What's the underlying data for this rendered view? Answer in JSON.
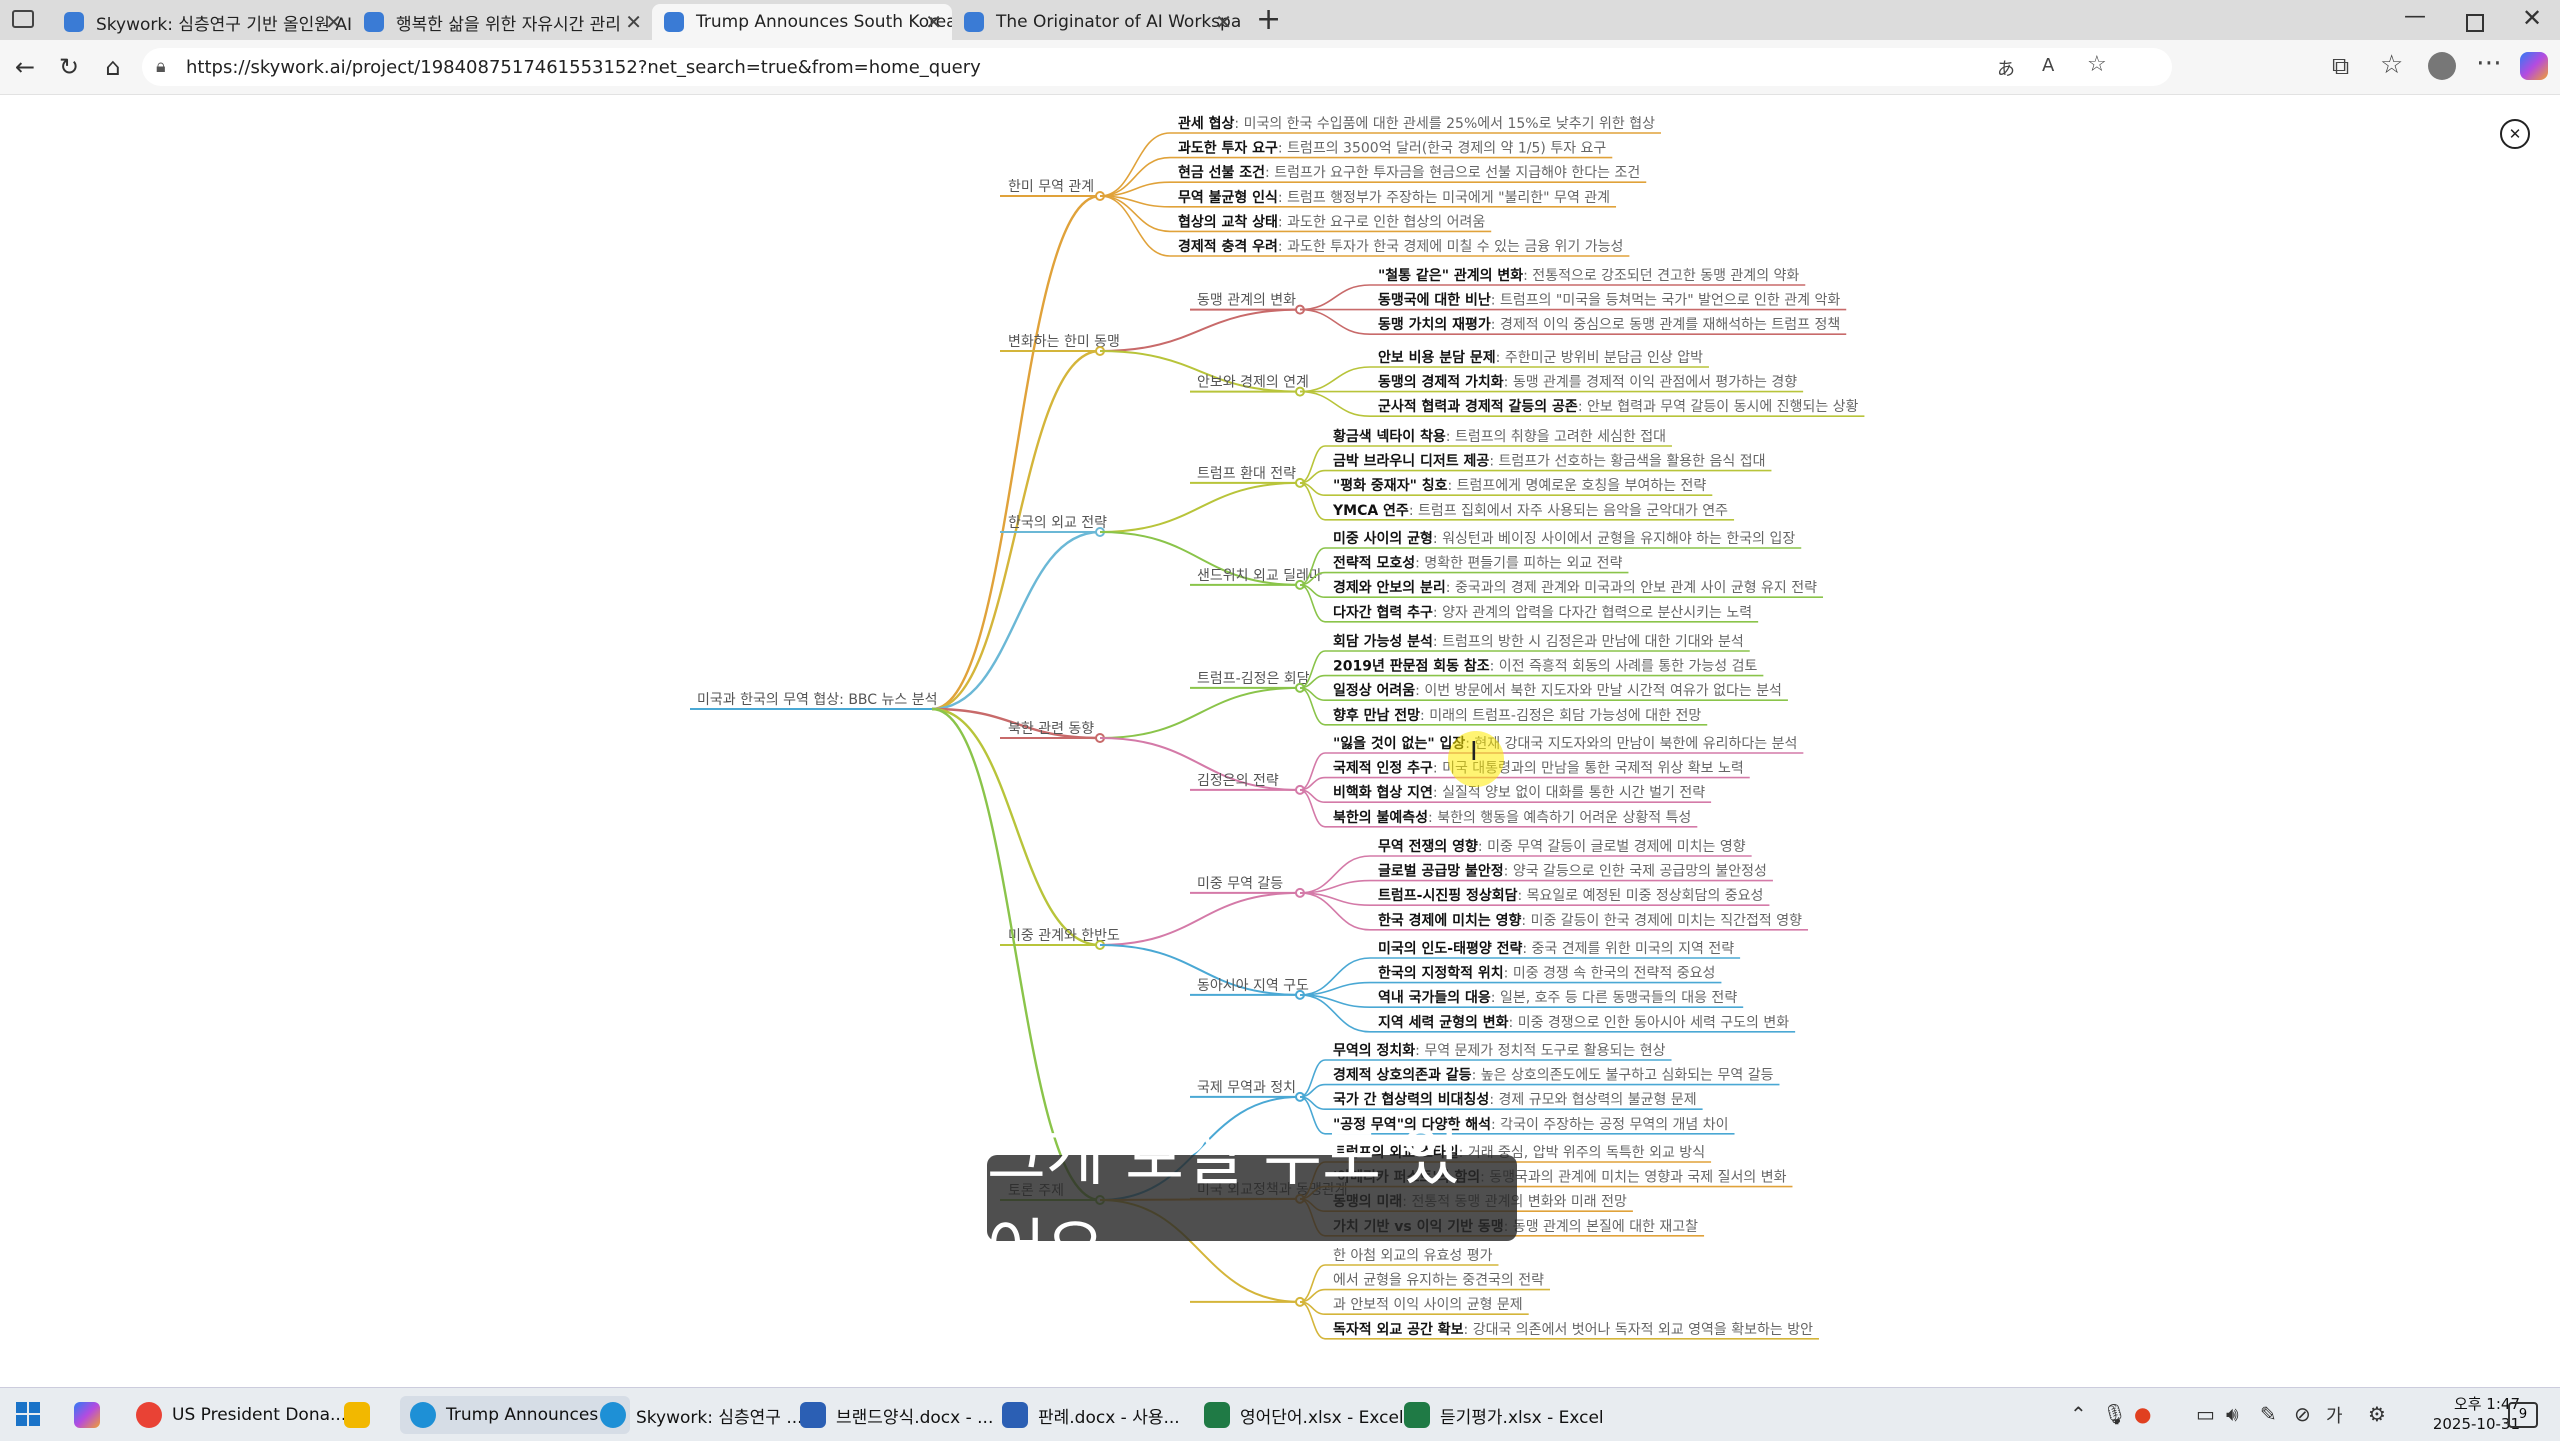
{
  "browser": {
    "tabs": [
      {
        "title": "Skywork: 심층연구 기반 올인원 AI",
        "favicon_color": "#3a7bd5"
      },
      {
        "title": "행복한 삶을 위한 자유시간 관리",
        "favicon_color": "#3a7bd5"
      },
      {
        "title": "Trump Announces South Korea Tr",
        "favicon_color": "#3a7bd5"
      },
      {
        "title": "The Originator of AI Workspace: A",
        "favicon_color": "#3a7bd5"
      }
    ],
    "active_tab": 2,
    "url": "https://skywork.ai/project/1984087517461553152?net_search=true&from=home_query"
  },
  "mindmap": {
    "root": "미국과 한국의 무역 협상: BBC 뉴스 분석",
    "colors": [
      "#e0a23a",
      "#d4b53a",
      "#6bb8d6",
      "#c86a6a",
      "#b8c43a",
      "#8ac44a",
      "#d47aa8",
      "#4aa8d4"
    ],
    "branches": [
      {
        "label": "한미 무역 관계",
        "leaves": [
          {
            "b": "관세 협상",
            "t": ": 미국의 한국 수입품에 대한 관세를 25%에서 15%로 낮추기 위한 협상"
          },
          {
            "b": "과도한 투자 요구",
            "t": ": 트럼프의 3500억 달러(한국 경제의 약 1/5) 투자 요구"
          },
          {
            "b": "현금 선불 조건",
            "t": ": 트럼프가 요구한 투자금을 현금으로 선불 지급해야 한다는 조건"
          },
          {
            "b": "무역 불균형 인식",
            "t": ": 트럼프 행정부가 주장하는 미국에게 \"불리한\" 무역 관계"
          },
          {
            "b": "협상의 교착 상태",
            "t": ": 과도한 요구로 인한 협상의 어려움"
          },
          {
            "b": "경제적 충격 우려",
            "t": ": 과도한 투자가 한국 경제에 미칠 수 있는 금융 위기 가능성"
          }
        ]
      },
      {
        "label": "변화하는 한미 동맹",
        "subs": [
          {
            "label": "동맹 관계의 변화",
            "leaves": [
              {
                "b": "\"철통 같은\" 관계의 변화",
                "t": ": 전통적으로 강조되던 견고한 동맹 관계의 약화"
              },
              {
                "b": "동맹국에 대한 비난",
                "t": ": 트럼프의 \"미국을 등쳐먹는 국가\" 발언으로 인한 관계 악화"
              },
              {
                "b": "동맹 가치의 재평가",
                "t": ": 경제적 이익 중심으로 동맹 관계를 재해석하는 트럼프 정책"
              }
            ]
          },
          {
            "label": "안보와 경제의 연계",
            "leaves": [
              {
                "b": "안보 비용 분담 문제",
                "t": ": 주한미군 방위비 분담금 인상 압박"
              },
              {
                "b": "동맹의 경제적 가치화",
                "t": ": 동맹 관계를 경제적 이익 관점에서 평가하는 경향"
              },
              {
                "b": "군사적 협력과 경제적 갈등의 공존",
                "t": ": 안보 협력과 무역 갈등이 동시에 진행되는 상황"
              }
            ]
          }
        ]
      },
      {
        "label": "한국의 외교 전략",
        "subs": [
          {
            "label": "트럼프 환대 전략",
            "leaves": [
              {
                "b": "황금색 넥타이 착용",
                "t": ": 트럼프의 취향을 고려한 세심한 접대"
              },
              {
                "b": "금박 브라우니 디저트 제공",
                "t": ": 트럼프가 선호하는 황금색을 활용한 음식 접대"
              },
              {
                "b": "\"평화 중재자\" 칭호",
                "t": ": 트럼프에게 명예로운 호칭을 부여하는 전략"
              },
              {
                "b": "YMCA 연주",
                "t": ": 트럼프 집회에서 자주 사용되는 음악을 군악대가 연주"
              }
            ]
          },
          {
            "label": "샌드위치 외교 딜레마",
            "leaves": [
              {
                "b": "미중 사이의 균형",
                "t": ": 워싱턴과 베이징 사이에서 균형을 유지해야 하는 한국의 입장"
              },
              {
                "b": "전략적 모호성",
                "t": ": 명확한 편들기를 피하는 외교 전략"
              },
              {
                "b": "경제와 안보의 분리",
                "t": ": 중국과의 경제 관계와 미국과의 안보 관계 사이 균형 유지 전략"
              },
              {
                "b": "다자간 협력 추구",
                "t": ": 양자 관계의 압력을 다자간 협력으로 분산시키는 노력"
              }
            ]
          }
        ]
      },
      {
        "label": "북한 관련 동향",
        "subs": [
          {
            "label": "트럼프-김정은 회담",
            "leaves": [
              {
                "b": "회담 가능성 분석",
                "t": ": 트럼프의 방한 시 김정은과 만남에 대한 기대와 분석"
              },
              {
                "b": "2019년 판문점 회동 참조",
                "t": ": 이전 즉흥적 회동의 사례를 통한 가능성 검토"
              },
              {
                "b": "일정상 어려움",
                "t": ": 이번 방문에서 북한 지도자와 만날 시간적 여유가 없다는 분석"
              },
              {
                "b": "향후 만남 전망",
                "t": ": 미래의 트럼프-김정은 회담 가능성에 대한 전망"
              }
            ]
          },
          {
            "label": "김정은의 전략",
            "leaves": [
              {
                "b": "\"잃을 것이 없는\" 입장",
                "t": ": 현재 강대국 지도자와의 만남이 북한에 유리하다는 분석"
              },
              {
                "b": "국제적 인정 추구",
                "t": ": 미국 대통령과의 만남을 통한 국제적 위상 확보 노력"
              },
              {
                "b": "비핵화 협상 지연",
                "t": ": 실질적 양보 없이 대화를 통한 시간 벌기 전략"
              },
              {
                "b": "북한의 불예측성",
                "t": ": 북한의 행동을 예측하기 어려운 상황적 특성"
              }
            ]
          }
        ]
      },
      {
        "label": "미중 관계와 한반도",
        "subs": [
          {
            "label": "미중 무역 갈등",
            "leaves": [
              {
                "b": "무역 전쟁의 영향",
                "t": ": 미중 무역 갈등이 글로벌 경제에 미치는 영향"
              },
              {
                "b": "글로벌 공급망 불안정",
                "t": ": 양국 갈등으로 인한 국제 공급망의 불안정성"
              },
              {
                "b": "트럼프-시진핑 정상회담",
                "t": ": 목요일로 예정된 미중 정상회담의 중요성"
              },
              {
                "b": "한국 경제에 미치는 영향",
                "t": ": 미중 갈등이 한국 경제에 미치는 직간접적 영향"
              }
            ]
          },
          {
            "label": "동아시아 지역 구도",
            "leaves": [
              {
                "b": "미국의 인도-태평양 전략",
                "t": ": 중국 견제를 위한 미국의 지역 전략"
              },
              {
                "b": "한국의 지정학적 위치",
                "t": ": 미중 경쟁 속 한국의 전략적 중요성"
              },
              {
                "b": "역내 국가들의 대응",
                "t": ": 일본, 호주 등 다른 동맹국들의 대응 전략"
              },
              {
                "b": "지역 세력 균형의 변화",
                "t": ": 미중 경쟁으로 인한 동아시아 세력 구도의 변화"
              }
            ]
          }
        ]
      },
      {
        "label": "토론 주제",
        "subs": [
          {
            "label": "국제 무역과 정치",
            "leaves": [
              {
                "b": "무역의 정치화",
                "t": ": 무역 문제가 정치적 도구로 활용되는 현상"
              },
              {
                "b": "경제적 상호의존과 갈등",
                "t": ": 높은 상호의존도에도 불구하고 심화되는 무역 갈등"
              },
              {
                "b": "국가 간 협상력의 비대칭성",
                "t": ": 경제 규모와 협상력의 불균형 문제"
              },
              {
                "b": "\"공정 무역\"의 다양한 해석",
                "t": ": 각국이 주장하는 공정 무역의 개념 차이"
              }
            ]
          },
          {
            "label": "미국 외교정책과 동맹관계",
            "leaves": [
              {
                "b": "트럼프의 외교 스타일",
                "t": ": 거래 중심, 압박 위주의 독특한 외교 방식"
              },
              {
                "b": "'아메리카 퍼스트'의 함의",
                "t": ": 동맹국과의 관계에 미치는 영향과 국제 질서의 변화"
              },
              {
                "b": "동맹의 미래",
                "t": ": 전통적 동맹 관계의 변화와 미래 전망"
              },
              {
                "b": "가치 기반 vs 이익 기반 동맹",
                "t": ": 동맹 관계의 본질에 대한 재고찰"
              }
            ]
          },
          {
            "label": "",
            "leaves": [
              {
                "b": "",
                "t": "한 아첨 외교의 유효성 평가"
              },
              {
                "b": "",
                "t": "에서 균형을 유지하는 중견국의 전략"
              },
              {
                "b": "",
                "t": "과 안보적 이익 사이의 균형 문제"
              },
              {
                "b": "독자적 외교 공간 확보",
                "t": ": 강대국 의존에서 벗어나 독자적 외교 영역을 확보하는 방안"
              }
            ]
          }
        ]
      }
    ]
  },
  "close_button_label": "✕",
  "subtitle": "크게 보실 수도 있어요",
  "taskbar": {
    "apps": [
      {
        "label": "US President Dona...",
        "color": "#e94235"
      },
      {
        "label": "",
        "color": "#f2b800"
      },
      {
        "label": "Trump Announces ...",
        "color": "#1e90d6"
      },
      {
        "label": "Skywork: 심층연구 ...",
        "color": "#1e90d6"
      },
      {
        "label": "브랜드양식.docx - ...",
        "color": "#2b5fb4"
      },
      {
        "label": "판례.docx - 사용...",
        "color": "#2b5fb4"
      },
      {
        "label": "영어단어.xlsx - Excel",
        "color": "#1f7a45"
      },
      {
        "label": "듣기평가.xlsx - Excel",
        "color": "#1f7a45"
      }
    ],
    "time": "오후 1:47",
    "date": "2025-10-31",
    "notification_count": "9"
  }
}
